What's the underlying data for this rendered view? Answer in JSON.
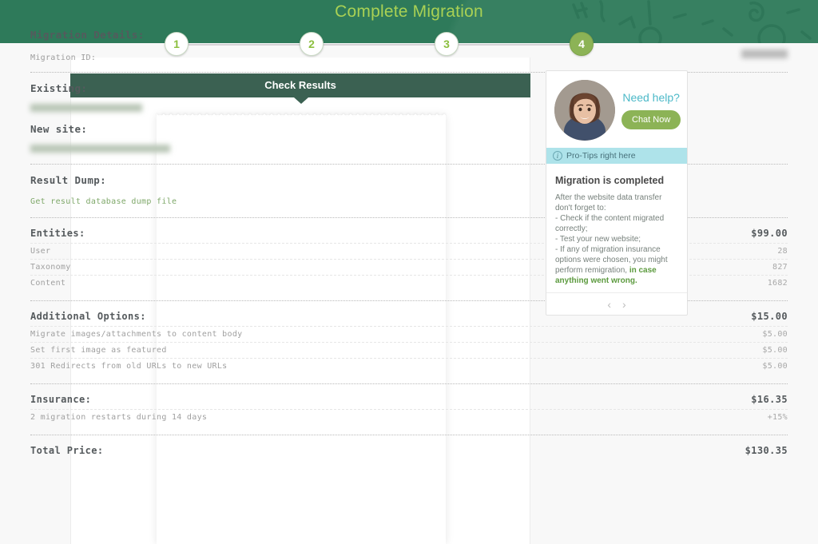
{
  "header": {
    "title": "Complete Migration",
    "title_color": "#a9d154",
    "bg_color": "#2e7a5a"
  },
  "stepper": {
    "steps": [
      {
        "label": "1",
        "active": false
      },
      {
        "label": "2",
        "active": false
      },
      {
        "label": "3",
        "active": false
      },
      {
        "label": "4",
        "active": true
      }
    ],
    "active_color": "#8cb356"
  },
  "section": {
    "heading": "Check Results"
  },
  "receipt": {
    "details_title": "Migration Details:",
    "migration_id_label": "Migration ID:",
    "migration_id_value": "",
    "existing_label": "Existing:",
    "existing_value": "",
    "new_site_label": "New site:",
    "new_site_value": "",
    "result_dump_label": "Result Dump:",
    "result_dump_link": "Get result database dump file",
    "groups": [
      {
        "name": "Entities:",
        "total": "$99.00",
        "items": [
          {
            "label": "User",
            "value": "28"
          },
          {
            "label": "Taxonomy",
            "value": "827"
          },
          {
            "label": "Content",
            "value": "1682"
          }
        ]
      },
      {
        "name": "Additional Options:",
        "total": "$15.00",
        "items": [
          {
            "label": "Migrate images/attachments to content body",
            "value": "$5.00"
          },
          {
            "label": "Set first image as featured",
            "value": "$5.00"
          },
          {
            "label": "301 Redirects from old URLs to new URLs",
            "value": "$5.00"
          }
        ]
      },
      {
        "name": "Insurance:",
        "total": "$16.35",
        "items": [
          {
            "label": "2 migration restarts during 14 days",
            "value": "+15%"
          }
        ]
      }
    ],
    "total_label": "Total Price:",
    "total_value": "$130.35"
  },
  "help": {
    "need_help_label": "Need help?",
    "chat_button_label": "Chat Now",
    "protips_bar_label": "Pro-Tips right here",
    "tips_title": "Migration is completed",
    "tips_body_part1": "After the website data transfer don't forget to:",
    "tips_body_part2": "- Check if the content migrated correctly;",
    "tips_body_part3": "- Test your new website;",
    "tips_body_part4": "- If any of migration insurance options were chosen, you might perform remigration, ",
    "tips_body_emphasis": "in case anything went wrong.",
    "prev_label": "‹",
    "next_label": "›",
    "accent_teal": "#4cb9c8",
    "accent_green": "#8cb356"
  }
}
